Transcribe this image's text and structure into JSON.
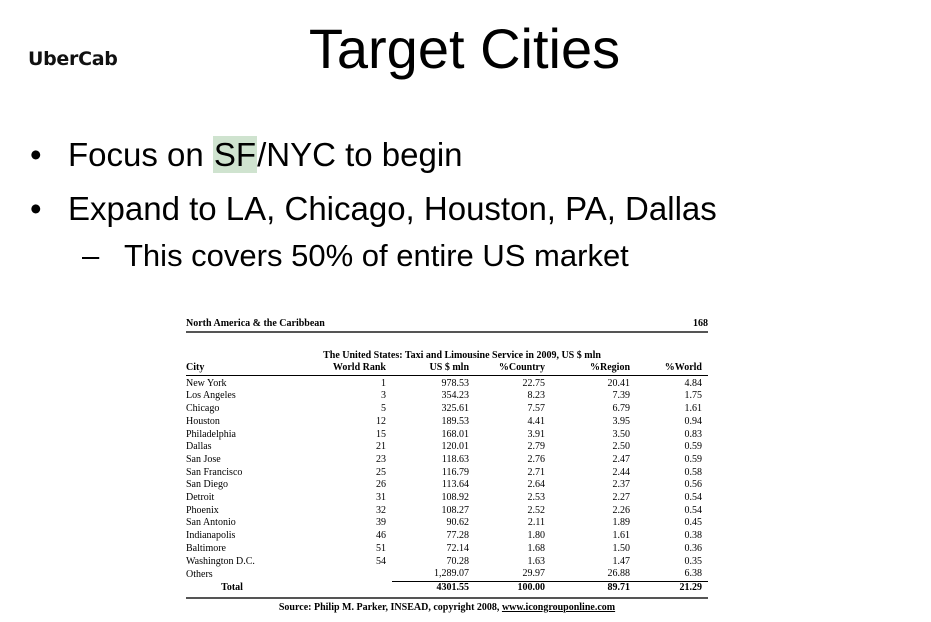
{
  "logo": "UberCab",
  "title": "Target Cities",
  "bullets": [
    {
      "prefix": "Focus on ",
      "highlight": "SF",
      "suffix": "/NYC to begin"
    },
    {
      "text": "Expand to LA, Chicago, Houston, PA, Dallas"
    }
  ],
  "sub_bullet": {
    "dash": "–",
    "text": "This covers 50% of entire US market"
  },
  "bullet_glyph": "•",
  "table_doc": {
    "region": "North America & the Caribbean",
    "page": "168",
    "title": "The United States: Taxi and Limousine Service in 2009, US $ mln",
    "headers": {
      "city": "City",
      "rank": "World Rank",
      "usd": "US $ mln",
      "country": "%Country",
      "region": "%Region",
      "world": "%World"
    },
    "rows": [
      {
        "city": "New York",
        "rank": "1",
        "usd": "978.53",
        "country": "22.75",
        "region": "20.41",
        "world": "4.84"
      },
      {
        "city": "Los Angeles",
        "rank": "3",
        "usd": "354.23",
        "country": "8.23",
        "region": "7.39",
        "world": "1.75"
      },
      {
        "city": "Chicago",
        "rank": "5",
        "usd": "325.61",
        "country": "7.57",
        "region": "6.79",
        "world": "1.61"
      },
      {
        "city": "Houston",
        "rank": "12",
        "usd": "189.53",
        "country": "4.41",
        "region": "3.95",
        "world": "0.94"
      },
      {
        "city": "Philadelphia",
        "rank": "15",
        "usd": "168.01",
        "country": "3.91",
        "region": "3.50",
        "world": "0.83"
      },
      {
        "city": "Dallas",
        "rank": "21",
        "usd": "120.01",
        "country": "2.79",
        "region": "2.50",
        "world": "0.59"
      },
      {
        "city": "San Jose",
        "rank": "23",
        "usd": "118.63",
        "country": "2.76",
        "region": "2.47",
        "world": "0.59"
      },
      {
        "city": "San Francisco",
        "rank": "25",
        "usd": "116.79",
        "country": "2.71",
        "region": "2.44",
        "world": "0.58"
      },
      {
        "city": "San Diego",
        "rank": "26",
        "usd": "113.64",
        "country": "2.64",
        "region": "2.37",
        "world": "0.56"
      },
      {
        "city": "Detroit",
        "rank": "31",
        "usd": "108.92",
        "country": "2.53",
        "region": "2.27",
        "world": "0.54"
      },
      {
        "city": "Phoenix",
        "rank": "32",
        "usd": "108.27",
        "country": "2.52",
        "region": "2.26",
        "world": "0.54"
      },
      {
        "city": "San Antonio",
        "rank": "39",
        "usd": "90.62",
        "country": "2.11",
        "region": "1.89",
        "world": "0.45"
      },
      {
        "city": "Indianapolis",
        "rank": "46",
        "usd": "77.28",
        "country": "1.80",
        "region": "1.61",
        "world": "0.38"
      },
      {
        "city": "Baltimore",
        "rank": "51",
        "usd": "72.14",
        "country": "1.68",
        "region": "1.50",
        "world": "0.36"
      },
      {
        "city": "Washington D.C.",
        "rank": "54",
        "usd": "70.28",
        "country": "1.63",
        "region": "1.47",
        "world": "0.35"
      },
      {
        "city": "Others",
        "rank": "",
        "usd": "1,289.07",
        "country": "29.97",
        "region": "26.88",
        "world": "6.38"
      }
    ],
    "total": {
      "label": "Total",
      "usd": "4301.55",
      "country": "100.00",
      "region": "89.71",
      "world": "21.29"
    },
    "source_prefix": "Source: Philip M. Parker, INSEAD, copyright 2008, ",
    "source_link": "www.icongrouponline.com"
  }
}
